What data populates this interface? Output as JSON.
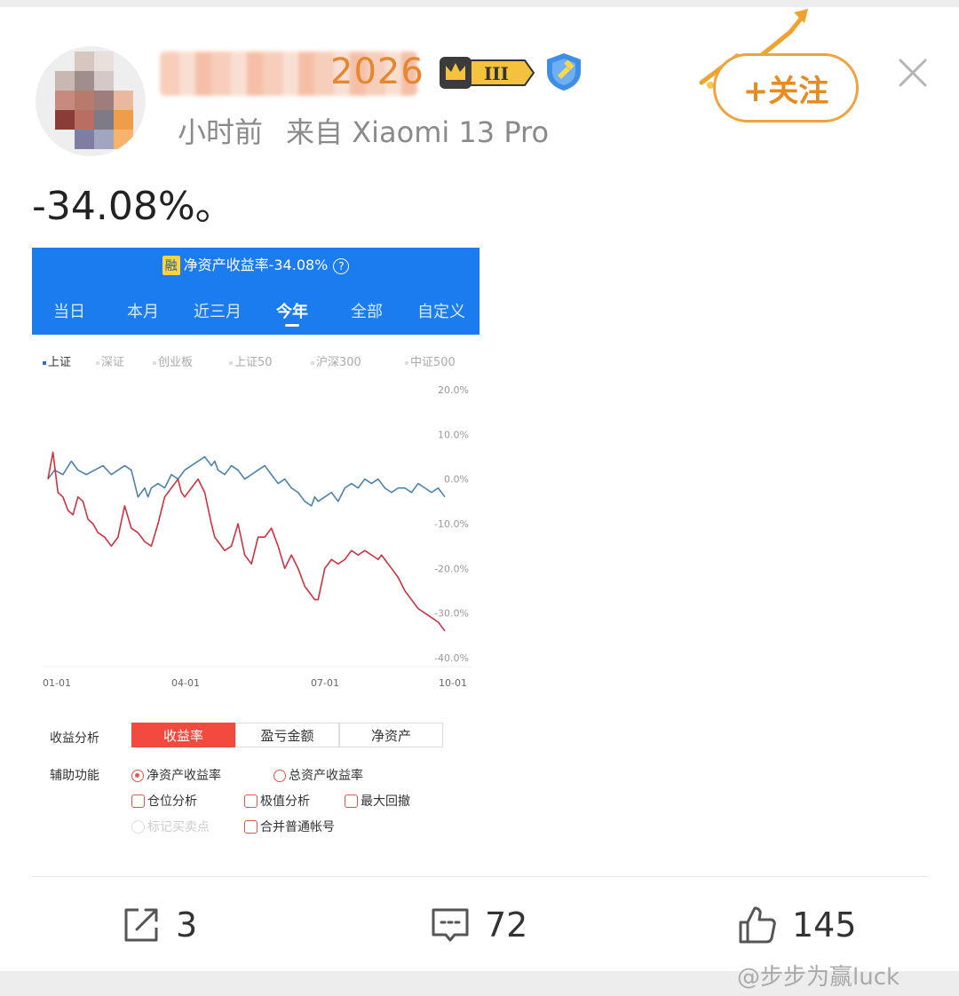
{
  "post": {
    "username_visible": "2026",
    "time": "小时前",
    "source": "来自 Xiaomi 13 Pro",
    "text": "-34.08%。",
    "follow_label": "+关注"
  },
  "screenshot": {
    "title_badge": "融",
    "title": "净资产收益率-34.08%",
    "help": "?",
    "tabs": [
      "当日",
      "本月",
      "近三月",
      "今年",
      "全部",
      "自定义"
    ],
    "active_tab": "今年",
    "indices": [
      "上证",
      "深证",
      "创业板",
      "上证50",
      "沪深300",
      "中证500"
    ],
    "active_index": "上证",
    "analysis_label": "收益分析",
    "segments": [
      "收益率",
      "盈亏金额",
      "净资产"
    ],
    "aux_label": "辅助功能",
    "radios": [
      "净资产收益率",
      "总资产收益率"
    ],
    "checks": [
      "仓位分析",
      "极值分析",
      "最大回撤"
    ],
    "disabled_check": "标记买卖点",
    "check_merge": "合并普通帐号"
  },
  "chart_data": {
    "type": "line",
    "x_ticks": [
      "01-01",
      "04-01",
      "07-01",
      "10-01"
    ],
    "y_ticks": [
      "20.0%",
      "10.0%",
      "0.0%",
      "-10.0%",
      "-20.0%",
      "-30.0%",
      "-40.0%"
    ],
    "ylim": [
      -40,
      20
    ],
    "colors": {
      "index": "#4a82b0",
      "account": "#d0313f"
    },
    "series": [
      {
        "name": "上证",
        "x": [
          0,
          4,
          9,
          14,
          18,
          23,
          28,
          33,
          38,
          42,
          46,
          50,
          54,
          58,
          60,
          62,
          66,
          70,
          74,
          78,
          82,
          86,
          90,
          94,
          98,
          100,
          102,
          106,
          110,
          114,
          118,
          122,
          126,
          130,
          134,
          138,
          142,
          146,
          150,
          154,
          158,
          160,
          162,
          166,
          170,
          174,
          178,
          182,
          186,
          190,
          194,
          198,
          200,
          202,
          206,
          210,
          214,
          218,
          222,
          226,
          230,
          234,
          238
        ],
        "values": [
          0,
          2,
          1,
          4,
          2,
          1,
          2,
          3,
          1,
          2,
          3,
          2,
          -4,
          -2,
          -4,
          -2,
          -1,
          -2,
          1,
          0,
          2,
          3,
          4,
          5,
          3,
          4,
          2,
          1,
          3,
          2,
          0,
          1,
          2,
          3,
          1,
          -1,
          0,
          -2,
          -3,
          -5,
          -6,
          -4,
          -5,
          -4,
          -3,
          -5,
          -2,
          -1,
          -2,
          0,
          -1,
          0,
          -1,
          -2,
          -3,
          -2,
          -2,
          -3,
          -1,
          -2,
          -3,
          -2,
          -4
        ]
      },
      {
        "name": "净资产收益率",
        "x": [
          0,
          3,
          6,
          9,
          12,
          15,
          18,
          21,
          24,
          27,
          30,
          34,
          38,
          42,
          46,
          50,
          54,
          58,
          62,
          66,
          70,
          74,
          78,
          80,
          82,
          86,
          90,
          94,
          98,
          100,
          102,
          106,
          110,
          114,
          118,
          122,
          126,
          130,
          134,
          138,
          142,
          146,
          150,
          154,
          158,
          160,
          162,
          166,
          170,
          174,
          178,
          182,
          186,
          190,
          194,
          198,
          200,
          202,
          206,
          210,
          214,
          218,
          222,
          226,
          230,
          234,
          238
        ],
        "values": [
          0,
          6,
          -3,
          -4,
          -7,
          -8,
          -4,
          -5,
          -9,
          -10,
          -12,
          -13,
          -15,
          -13,
          -6,
          -11,
          -12,
          -14,
          -15,
          -10,
          -4,
          -2,
          0,
          -3,
          -4,
          -2,
          0,
          -3,
          -10,
          -13,
          -14,
          -16,
          -15,
          -10,
          -17,
          -19,
          -13,
          -13,
          -11,
          -15,
          -20,
          -17,
          -20,
          -24,
          -26,
          -27,
          -27,
          -20,
          -18,
          -19,
          -18,
          -16,
          -17,
          -16,
          -17,
          -18,
          -17,
          -18,
          -20,
          -22,
          -25,
          -27,
          -29,
          -30,
          -31,
          -32,
          -34
        ]
      }
    ]
  },
  "actions": {
    "repost_count": "3",
    "comment_count": "72",
    "like_count": "145"
  },
  "watermark": "@步步为赢luck"
}
